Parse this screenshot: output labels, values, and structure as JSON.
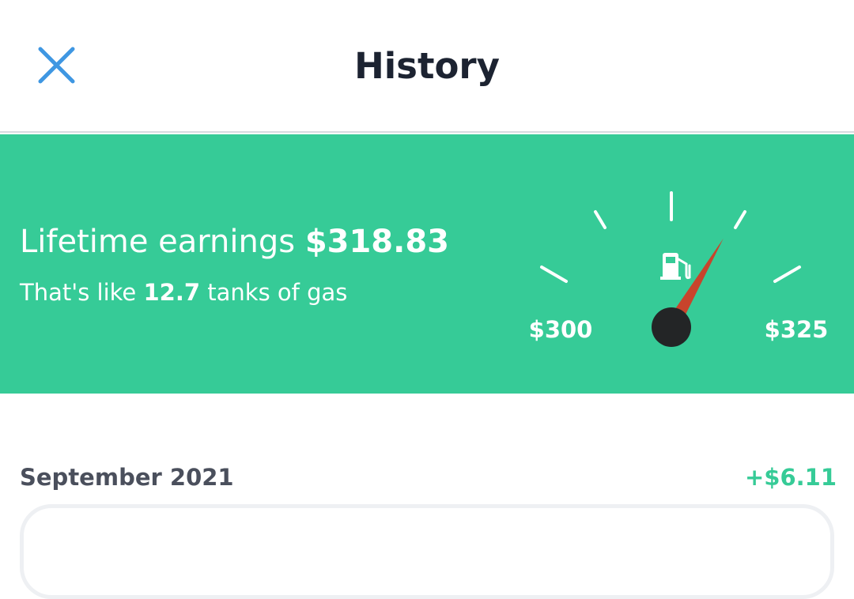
{
  "header": {
    "title": "History",
    "close_icon": "close-icon"
  },
  "banner": {
    "earnings_prefix": "Lifetime earnings",
    "earnings_amount": "$318.83",
    "tanks_prefix": "That's like",
    "tanks_count": "12.7",
    "tanks_suffix": "tanks of gas",
    "gauge": {
      "min_label": "$300",
      "max_label": "$325",
      "min_value": 300,
      "max_value": 325,
      "current_value": 318.83,
      "icon": "gas-pump-icon"
    }
  },
  "history": {
    "month_label": "September 2021",
    "month_delta": "+$6.11"
  },
  "colors": {
    "accent_green": "#36cb97",
    "close_blue": "#3f97e2",
    "needle_red": "#c8442c",
    "title_dark": "#1c2331"
  }
}
